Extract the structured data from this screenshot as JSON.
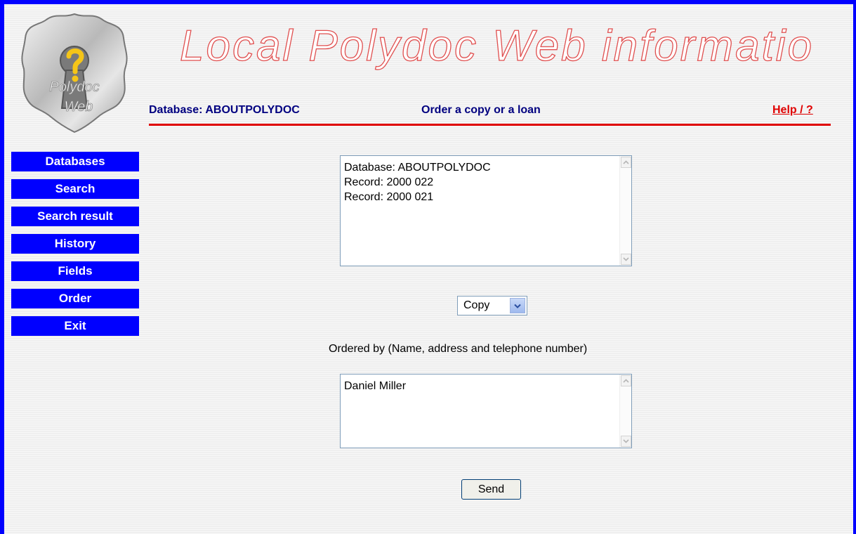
{
  "header": {
    "title": "Local Polydoc Web information",
    "logo_text": [
      "Polydoc",
      "Web"
    ],
    "database_label": "Database: ABOUTPOLYDOC",
    "page_title": "Order a copy or a loan",
    "help_link": "Help / ?"
  },
  "sidebar": {
    "items": [
      {
        "label": "Databases"
      },
      {
        "label": "Search"
      },
      {
        "label": "Search result"
      },
      {
        "label": "History"
      },
      {
        "label": "Fields"
      },
      {
        "label": "Order"
      },
      {
        "label": "Exit"
      }
    ]
  },
  "order": {
    "records_lines": [
      "Database: ABOUTPOLYDOC",
      "Record: 2000 022",
      "Record: 2000 021"
    ],
    "type_selected": "Copy",
    "ordered_by_label": "Ordered by (Name, address and telephone number)",
    "ordered_by_value": "Daniel Miller",
    "send_label": "Send"
  },
  "colors": {
    "frame": "#0000ff",
    "menu_bg": "#0000ff",
    "menu_text": "#ffffff",
    "accent_red": "#e00000",
    "header_text": "#000080"
  },
  "icons": {
    "logo": "polydoc-keyhole-logo",
    "scroll_up": "chevron-up-icon",
    "scroll_down": "chevron-down-icon",
    "select_arrow": "chevron-down-icon"
  }
}
